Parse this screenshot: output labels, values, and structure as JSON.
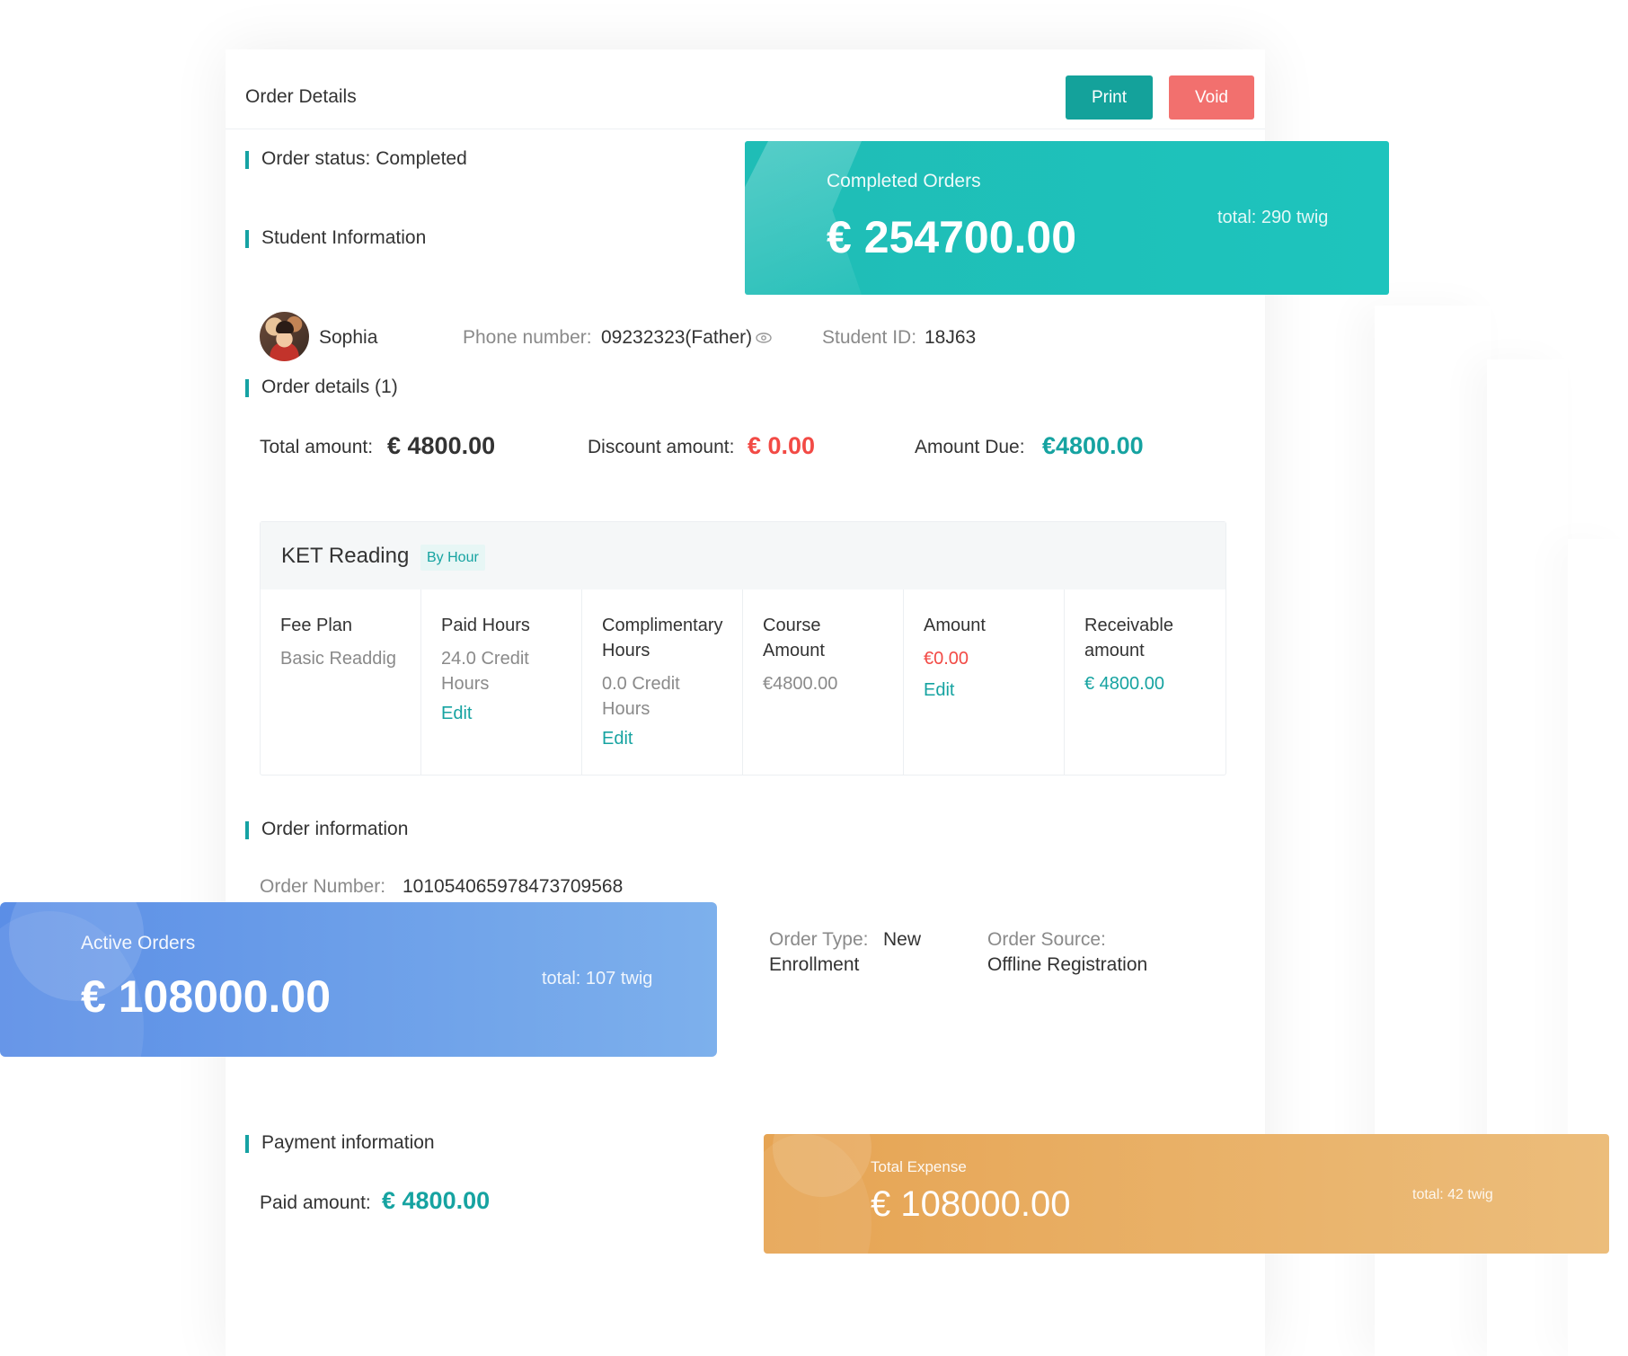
{
  "header": {
    "title": "Order Details",
    "print_label": "Print",
    "void_label": "Void"
  },
  "status": {
    "label": "Order status:",
    "value": "Completed"
  },
  "student": {
    "section_title": "Student Information",
    "name": "Sophia",
    "phone_label": "Phone number:",
    "phone_value": "09232323(Father)",
    "id_label": "Student ID:",
    "id_value": "18J63"
  },
  "order_details": {
    "section_title": "Order details (1)",
    "total_label": "Total amount:",
    "total_value": "€ 4800.00",
    "discount_label": "Discount amount:",
    "discount_value": "€ 0.00",
    "due_label": "Amount Due:",
    "due_value": "€4800.00"
  },
  "course": {
    "title": "KET Reading",
    "tag": "By Hour",
    "columns": [
      {
        "header": "Fee Plan",
        "value": "Basic Readdig",
        "edit": ""
      },
      {
        "header": "Paid Hours",
        "value": "24.0 Credit\nHours",
        "edit": "Edit"
      },
      {
        "header": "Complimentary\nHours",
        "value": "0.0 Credit\nHours",
        "edit": "Edit"
      },
      {
        "header": "Course\nAmount",
        "value": "€4800.00",
        "edit": ""
      },
      {
        "header": "Amount",
        "value": "€0.00",
        "edit": "Edit"
      },
      {
        "header": "Receivable\namount",
        "value": "€ 4800.00",
        "edit": ""
      }
    ]
  },
  "order_info": {
    "section_title": "Order information",
    "number_label": "Order Number:",
    "number_value": "101054065978473709568",
    "type_label": "Order Type:",
    "type_value": "New",
    "type_value2": "Enrollment",
    "source_label": "Order Source:",
    "source_value": "Offline Registration"
  },
  "payment": {
    "section_title": "Payment information",
    "paid_label": "Paid amount:",
    "paid_value": "€ 4800.00"
  },
  "stats": {
    "completed": {
      "title": "Completed Orders",
      "amount": "€ 254700.00",
      "total": "total:  290 twig"
    },
    "active": {
      "title": "Active Orders",
      "amount": "€ 108000.00",
      "total": "total:  107 twig"
    },
    "expense": {
      "title": "Total Expense",
      "amount": "€ 108000.00",
      "total": "total:  42 twig"
    }
  },
  "colors": {
    "accent": "#16a3a1",
    "danger": "#f24a45",
    "print_btn": "#14a29b",
    "void_btn": "#f2706e"
  },
  "icons": [
    "eye-icon"
  ]
}
